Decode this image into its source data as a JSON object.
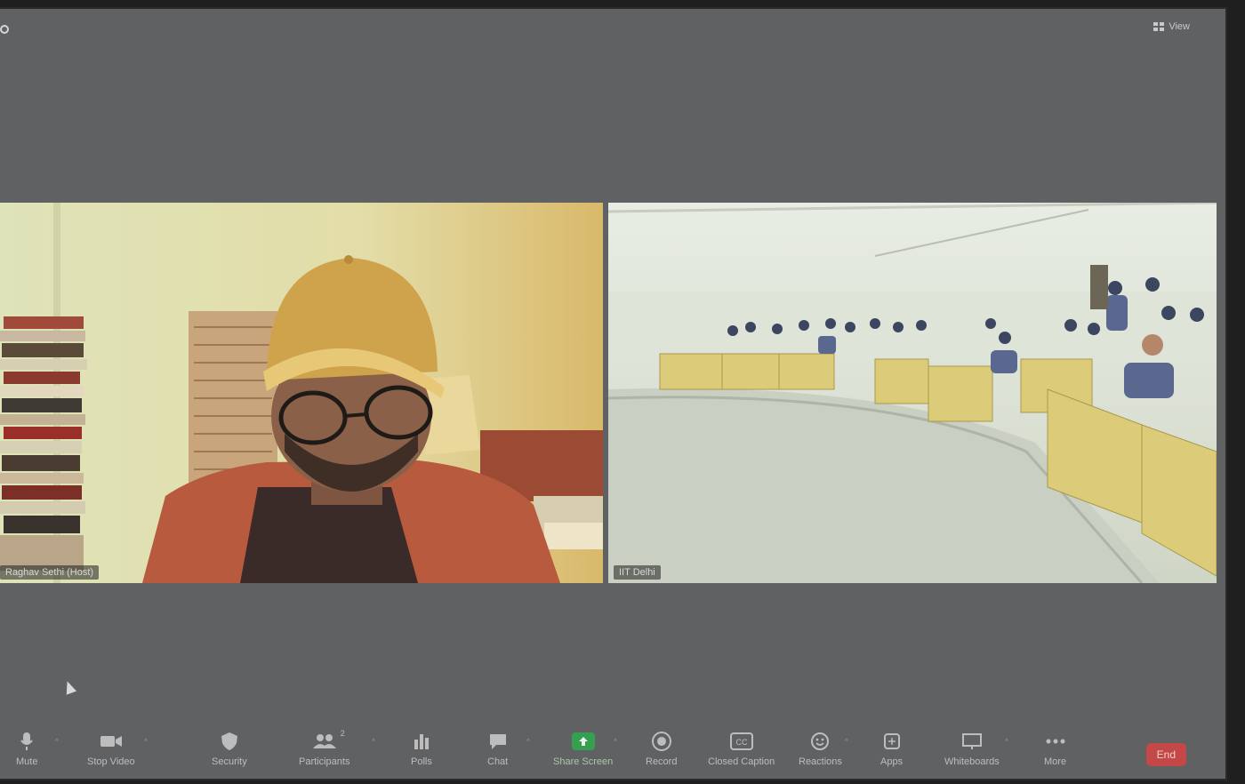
{
  "window": {
    "view_label": "View"
  },
  "participants": [
    {
      "name": "Raghav Sethi (Host)"
    },
    {
      "name": "IIT Delhi"
    }
  ],
  "toolbar": {
    "unmute": "Mute",
    "stop_video": "Stop Video",
    "security": "Security",
    "participants": "Participants",
    "participants_count": "2",
    "polls": "Polls",
    "chat": "Chat",
    "share_screen": "Share Screen",
    "record": "Record",
    "closed_caption": "Closed Caption",
    "reactions": "Reactions",
    "apps": "Apps",
    "whiteboards": "Whiteboards",
    "more": "More",
    "end": "End"
  },
  "colors": {
    "end_button": "#c44848",
    "share_screen": "#35a04f",
    "background": "#5f6163"
  }
}
